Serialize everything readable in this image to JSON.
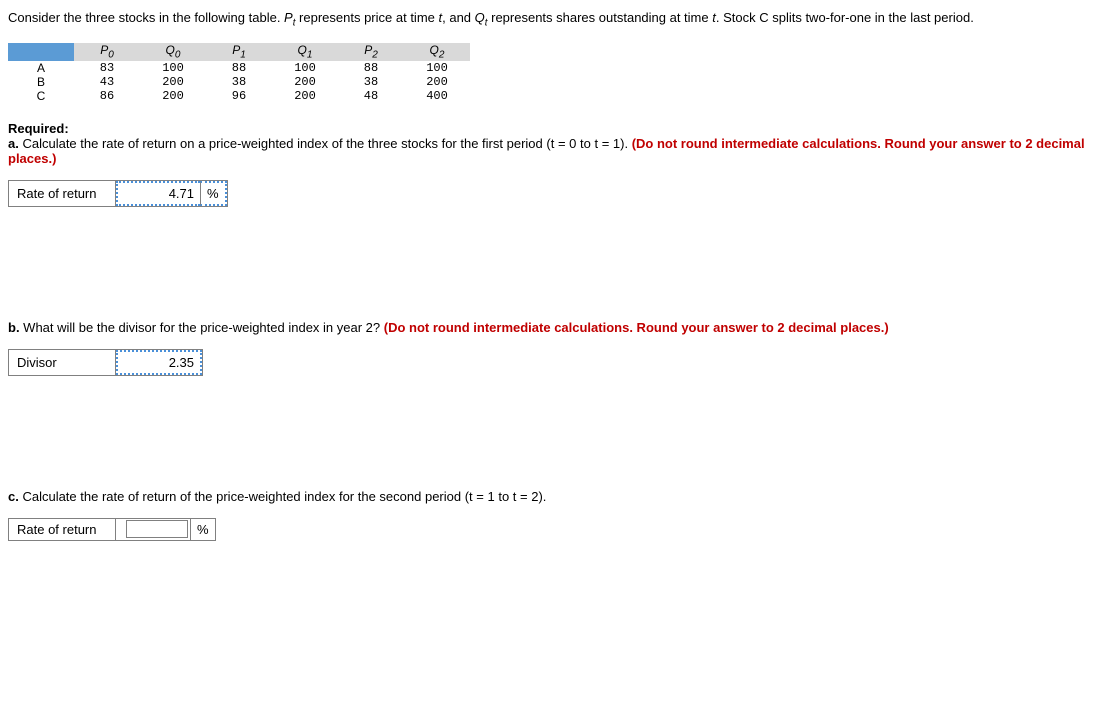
{
  "intro_pre": "Consider the three stocks in the following table. ",
  "p_sym": "P",
  "p_sub": "t",
  "intro_mid1": " represents price at time ",
  "t_text": "t",
  "intro_mid2": ", and ",
  "q_sym": "Q",
  "q_sub": "t",
  "intro_mid3": " represents shares outstanding at time ",
  "intro_end": ". Stock C splits two-for-one in the last period.",
  "headers": [
    "",
    "P0",
    "Q0",
    "P1",
    "Q1",
    "P2",
    "Q2"
  ],
  "rows": [
    {
      "label": "A",
      "vals": [
        "83",
        "100",
        "88",
        "100",
        "88",
        "100"
      ]
    },
    {
      "label": "B",
      "vals": [
        "43",
        "200",
        "38",
        "200",
        "38",
        "200"
      ]
    },
    {
      "label": "C",
      "vals": [
        "86",
        "200",
        "96",
        "200",
        "48",
        "400"
      ]
    }
  ],
  "required": "Required:",
  "qa_label": "a.",
  "qa_text": "Calculate the rate of return on a price-weighted index of the three stocks for the first period (",
  "qa_t0": "t",
  "qa_eq0": " = 0 to ",
  "qa_t1": "t",
  "qa_eq1": " = 1). ",
  "qa_red": "(Do not round intermediate calculations. Round your answer to 2 decimal places.)",
  "ans_a_label": "Rate of return",
  "ans_a_value": "4.71",
  "ans_a_unit": "%",
  "qb_label": "b.",
  "qb_text": " What will be the divisor for the price-weighted index in year 2? ",
  "qb_red": "(Do not round intermediate calculations. Round your answer to 2 decimal places.)",
  "ans_b_label": "Divisor",
  "ans_b_value": "2.35",
  "qc_label": "c.",
  "qc_text": " Calculate the rate of return of the price-weighted index for the second period (",
  "qc_t1": "t",
  "qc_eq1": " = 1 to ",
  "qc_t2": "t",
  "qc_eq2": " = 2).",
  "ans_c_label": "Rate of return",
  "ans_c_unit": "%"
}
